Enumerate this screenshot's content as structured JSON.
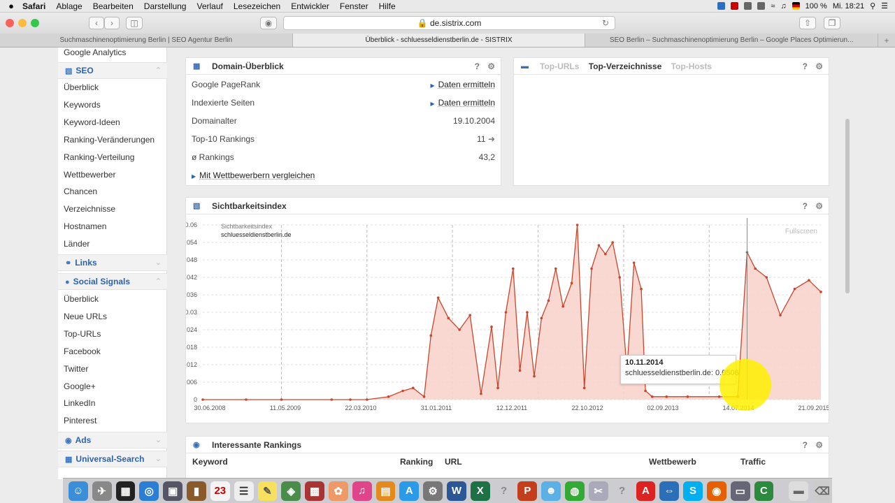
{
  "menubar": {
    "apple": "",
    "items": [
      "Safari",
      "Ablage",
      "Bearbeiten",
      "Darstellung",
      "Verlauf",
      "Lesezeichen",
      "Entwickler",
      "Fenster",
      "Hilfe"
    ],
    "battery": "100 %",
    "clock": "Mi. 18:21"
  },
  "browser": {
    "url": "de.sistrix.com",
    "tabs": [
      "Suchmaschinenoptimierung Berlin | SEO Agentur Berlin",
      "Überblick - schluesseldienstberlin.de - SISTRIX",
      "SEO Berlin – Suchmaschinenoptimierung Berlin – Google Places Optimierun..."
    ]
  },
  "sidebar": {
    "top_item": "Google Analytics",
    "seo_header": "SEO",
    "seo_items": [
      "Überblick",
      "Keywords",
      "Keyword-Ideen",
      "Ranking-Veränderungen",
      "Ranking-Verteilung",
      "Wettbewerber",
      "Chancen",
      "Verzeichnisse",
      "Hostnamen",
      "Länder"
    ],
    "links_header": "Links",
    "social_header": "Social Signals",
    "social_items": [
      "Überblick",
      "Neue URLs",
      "Top-URLs",
      "Facebook",
      "Twitter",
      "Google+",
      "LinkedIn",
      "Pinterest"
    ],
    "ads_header": "Ads",
    "universal_header": "Universal-Search"
  },
  "domain_panel": {
    "title": "Domain-Überblick",
    "rows": [
      {
        "label": "Google PageRank",
        "value": "Daten ermitteln"
      },
      {
        "label": "Indexierte Seiten",
        "value": "Daten ermitteln"
      },
      {
        "label": "Domainalter",
        "value": "19.10.2004"
      },
      {
        "label": "Top-10 Rankings",
        "value": "11"
      },
      {
        "label": "ø Rankings",
        "value": "43,2"
      }
    ],
    "compare_link": "Mit Wettbewerbern vergleichen"
  },
  "top_panel": {
    "tabs": [
      "Top-URLs",
      "Top-Verzeichnisse",
      "Top-Hosts"
    ],
    "active_tab": "Top-Verzeichnisse"
  },
  "vis_panel": {
    "title": "Sichtbarkeitsindex",
    "fullscreen": "Fullscreen"
  },
  "rankings_panel": {
    "title": "Interessante Rankings",
    "columns": [
      "Keyword",
      "Ranking",
      "URL",
      "Wettbewerb",
      "Traffic"
    ]
  },
  "tooltip": {
    "date": "10.11.2014",
    "text": "schluesseldienstberlin.de: 0.0506"
  },
  "colors": {
    "accent": "#2a63b3",
    "series": "#c9462c",
    "fill": "#f7d4cc"
  },
  "chart_data": {
    "type": "area",
    "series_name": "schluesseldienstberlin.de",
    "legend_title": "Sichtbarkeitsindex",
    "ylim": [
      0,
      0.06
    ],
    "yticks": [
      "0",
      "0.006",
      "0.012",
      "0.018",
      "0.024",
      "0.03",
      "0.036",
      "0.042",
      "0.048",
      "0.054",
      "0.06"
    ],
    "xticks": [
      "30.06.2008",
      "11.05.2009",
      "22.03.2010",
      "31.01.2011",
      "12.12.2011",
      "22.10.2012",
      "02.09.2013",
      "14.07.2014",
      "21.09.2015"
    ],
    "x": [
      "2008-06-30",
      "2009-01-01",
      "2009-06-01",
      "2010-01-01",
      "2010-03-22",
      "2010-06-01",
      "2010-09-01",
      "2010-11-01",
      "2010-12-15",
      "2011-01-31",
      "2011-03-01",
      "2011-04-01",
      "2011-05-15",
      "2011-07-01",
      "2011-08-15",
      "2011-10-01",
      "2011-11-15",
      "2011-12-12",
      "2012-01-15",
      "2012-02-15",
      "2012-03-15",
      "2012-04-15",
      "2012-05-15",
      "2012-06-15",
      "2012-07-15",
      "2012-08-15",
      "2012-09-15",
      "2012-10-22",
      "2012-11-15",
      "2012-12-15",
      "2013-01-15",
      "2013-02-15",
      "2013-03-15",
      "2013-04-15",
      "2013-05-15",
      "2013-06-15",
      "2013-07-15",
      "2013-08-15",
      "2013-09-02",
      "2013-10-01",
      "2013-12-01",
      "2014-03-01",
      "2014-07-14",
      "2014-10-01",
      "2014-11-10",
      "2014-12-15",
      "2015-02-01",
      "2015-04-01",
      "2015-06-01",
      "2015-08-01",
      "2015-09-21"
    ],
    "y": [
      0,
      0,
      0,
      0,
      0,
      0,
      0.001,
      0.003,
      0.004,
      0.001,
      0.022,
      0.035,
      0.028,
      0.024,
      0.029,
      0.002,
      0.025,
      0.004,
      0.03,
      0.045,
      0.01,
      0.03,
      0.008,
      0.028,
      0.034,
      0.045,
      0.032,
      0.04,
      0.06,
      0.004,
      0.045,
      0.053,
      0.05,
      0.054,
      0.042,
      0.01,
      0.047,
      0.038,
      0.003,
      0.001,
      0.001,
      0.001,
      0.001,
      0.001,
      0.0506,
      0.045,
      0.042,
      0.029,
      0.038,
      0.041,
      0.037
    ]
  }
}
